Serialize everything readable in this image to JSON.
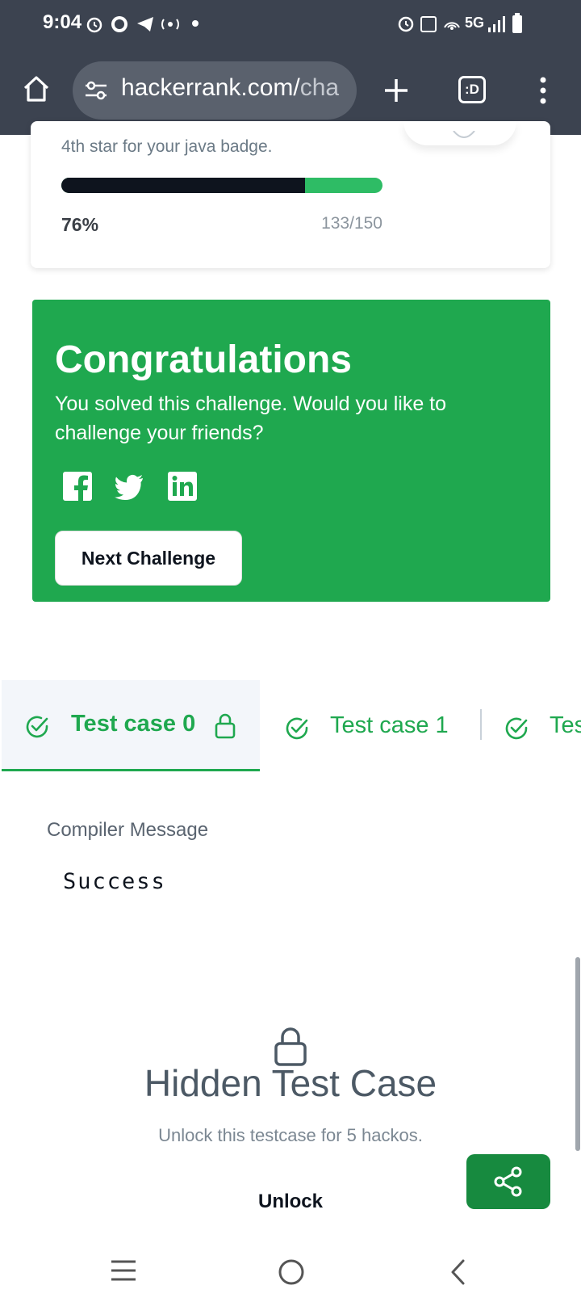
{
  "status_bar": {
    "time": "9:04",
    "network": "5G"
  },
  "browser": {
    "url_main": "hackerrank.com/",
    "url_dim": "cha",
    "tab_label": ":D"
  },
  "badge_card": {
    "text": "4th star for your java badge.",
    "progress_percent": 76,
    "percent_label": "76%",
    "count_label": "133/150"
  },
  "congrats": {
    "title": "Congratulations",
    "subtitle": "You solved this challenge. Would you like to challenge your friends?",
    "next_button": "Next Challenge",
    "social": [
      "facebook-icon",
      "twitter-icon",
      "linkedin-icon"
    ]
  },
  "tabs": [
    {
      "label": "Test case 0",
      "locked": true,
      "active": true
    },
    {
      "label": "Test case 1",
      "locked": false,
      "active": false
    },
    {
      "label": "Tes",
      "locked": false,
      "active": false
    }
  ],
  "compiler": {
    "label": "Compiler Message",
    "value": "Success"
  },
  "hidden": {
    "title": "Hidden Test Case",
    "subtitle": "Unlock this testcase for 5 hackos.",
    "unlock_label": "Unlock"
  },
  "colors": {
    "accent": "#1fa84f",
    "dark": "#0e141e",
    "header": "#3c4350"
  }
}
